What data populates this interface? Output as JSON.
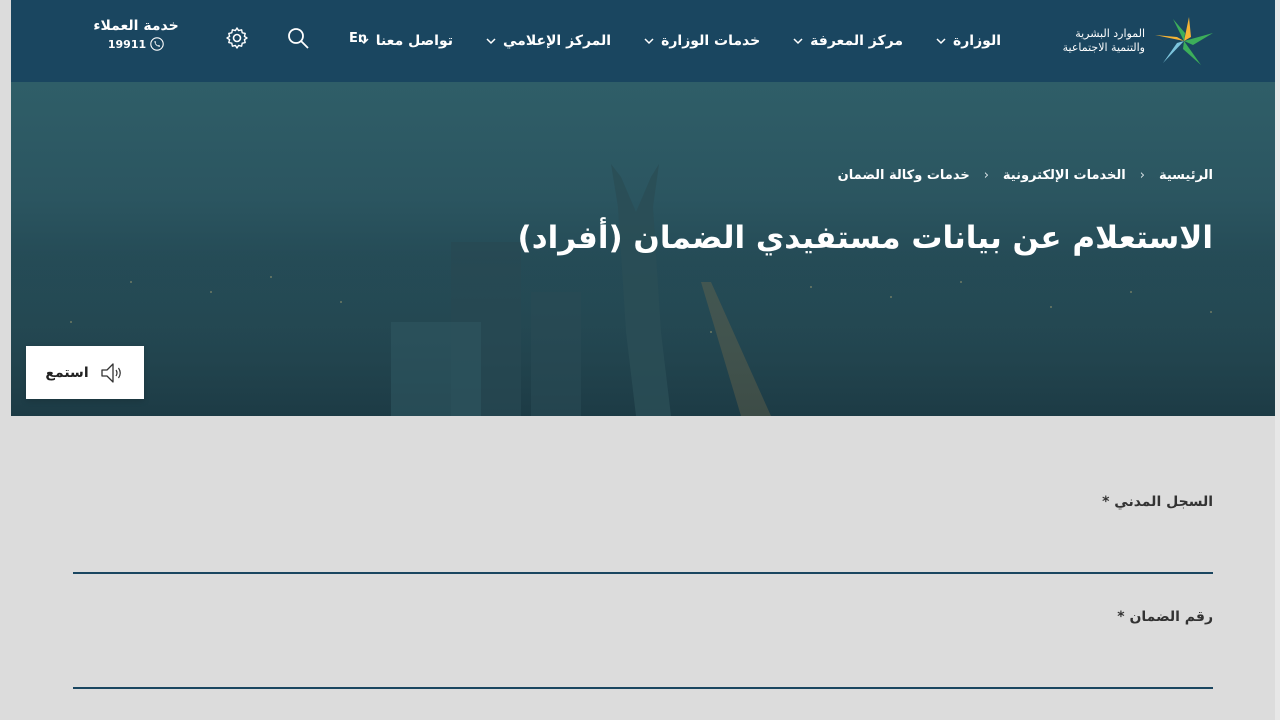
{
  "logo": {
    "line1": "الموارد البشرية",
    "line2": "والتنمية الاجتماعية"
  },
  "nav": {
    "items": [
      {
        "label": "الوزارة"
      },
      {
        "label": "مركز المعرفة"
      },
      {
        "label": "خدمات الوزارة"
      },
      {
        "label": "المركز الإعلامي"
      },
      {
        "label": "تواصل معنا"
      }
    ],
    "lang": "En",
    "search_icon": "search-icon",
    "settings_icon": "gear-icon"
  },
  "customer_service": {
    "title": "خدمة العملاء",
    "phone": "19911"
  },
  "breadcrumb": {
    "home": "الرئيسية",
    "eservices": "الخدمات الإلكترونية",
    "current": "خدمات وكالة الضمان"
  },
  "hero": {
    "title": "الاستعلام عن بيانات مستفيدي الضمان (أفراد)"
  },
  "listen": {
    "label": "استمع"
  },
  "form": {
    "civil_id_label": "السجل المدني *",
    "civil_id_value": "",
    "guarantee_label": "رقم الضمان *",
    "guarantee_value": ""
  },
  "colors": {
    "header_bg": "#1a4660",
    "page_bg": "#dcdcdc",
    "accent_green": "#3cae5a"
  }
}
